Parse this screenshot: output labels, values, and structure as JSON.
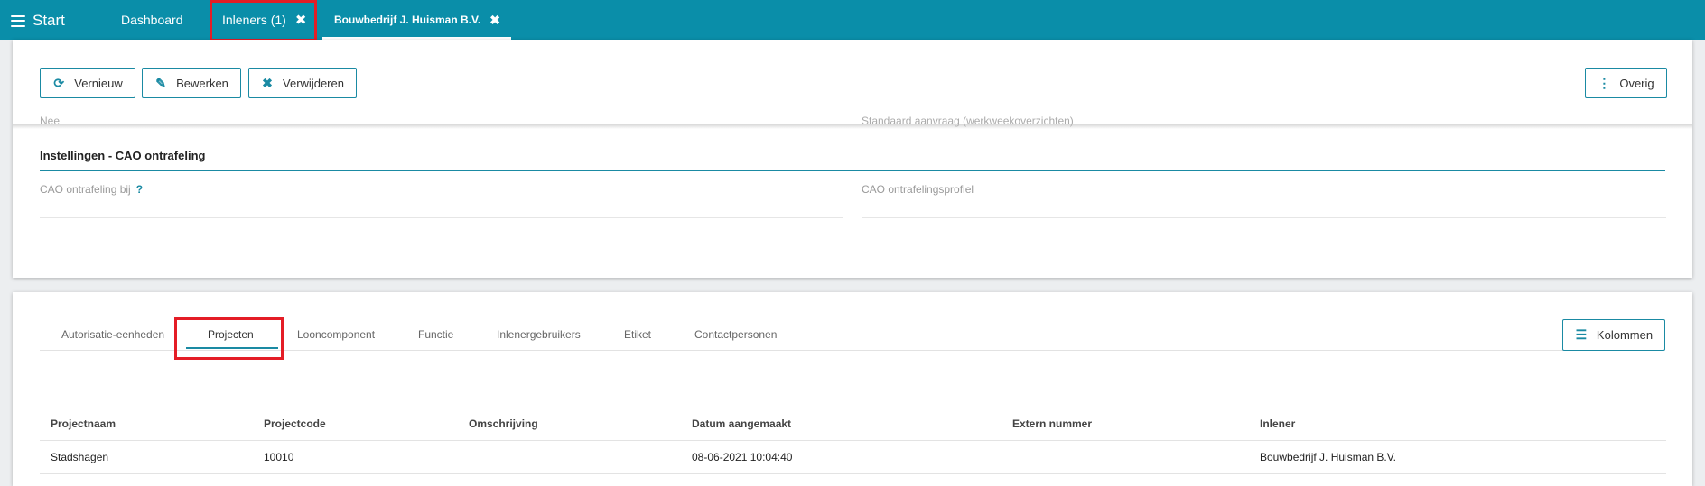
{
  "topbar": {
    "start_label": "Start",
    "tabs": [
      {
        "label": "Dashboard"
      },
      {
        "label": "Inleners (1)",
        "close": "✖"
      },
      {
        "label": "Bouwbedrijf J. Huisman B.V.",
        "close": "✖"
      }
    ]
  },
  "toolbar": {
    "vernieuw": "Vernieuw",
    "bewerken": "Bewerken",
    "verwijderen": "Verwijderen",
    "overig": "Overig"
  },
  "details": {
    "cut_left": "Nee",
    "cut_right": "Standaard aanvraag (werkweekoverzichten)",
    "section_title": "Instellingen - CAO ontrafeling",
    "field_left": "CAO ontrafeling bij",
    "help": "?",
    "field_right": "CAO ontrafelingsprofiel"
  },
  "bottom_tabs": [
    {
      "label": "Autorisatie-eenheden"
    },
    {
      "label": "Projecten"
    },
    {
      "label": "Looncomponent"
    },
    {
      "label": "Functie"
    },
    {
      "label": "Inlenergebruikers"
    },
    {
      "label": "Etiket"
    },
    {
      "label": "Contactpersonen"
    }
  ],
  "kolommen": "Kolommen",
  "table": {
    "headers": [
      "Projectnaam",
      "Projectcode",
      "Omschrijving",
      "Datum aangemaakt",
      "Extern nummer",
      "Inlener"
    ],
    "rows": [
      [
        "Stadshagen",
        "10010",
        "",
        "08-06-2021 10:04:40",
        "",
        "Bouwbedrijf J. Huisman B.V."
      ]
    ]
  },
  "colors": {
    "accent": "#0a8ea9",
    "highlight": "#e41d26"
  }
}
